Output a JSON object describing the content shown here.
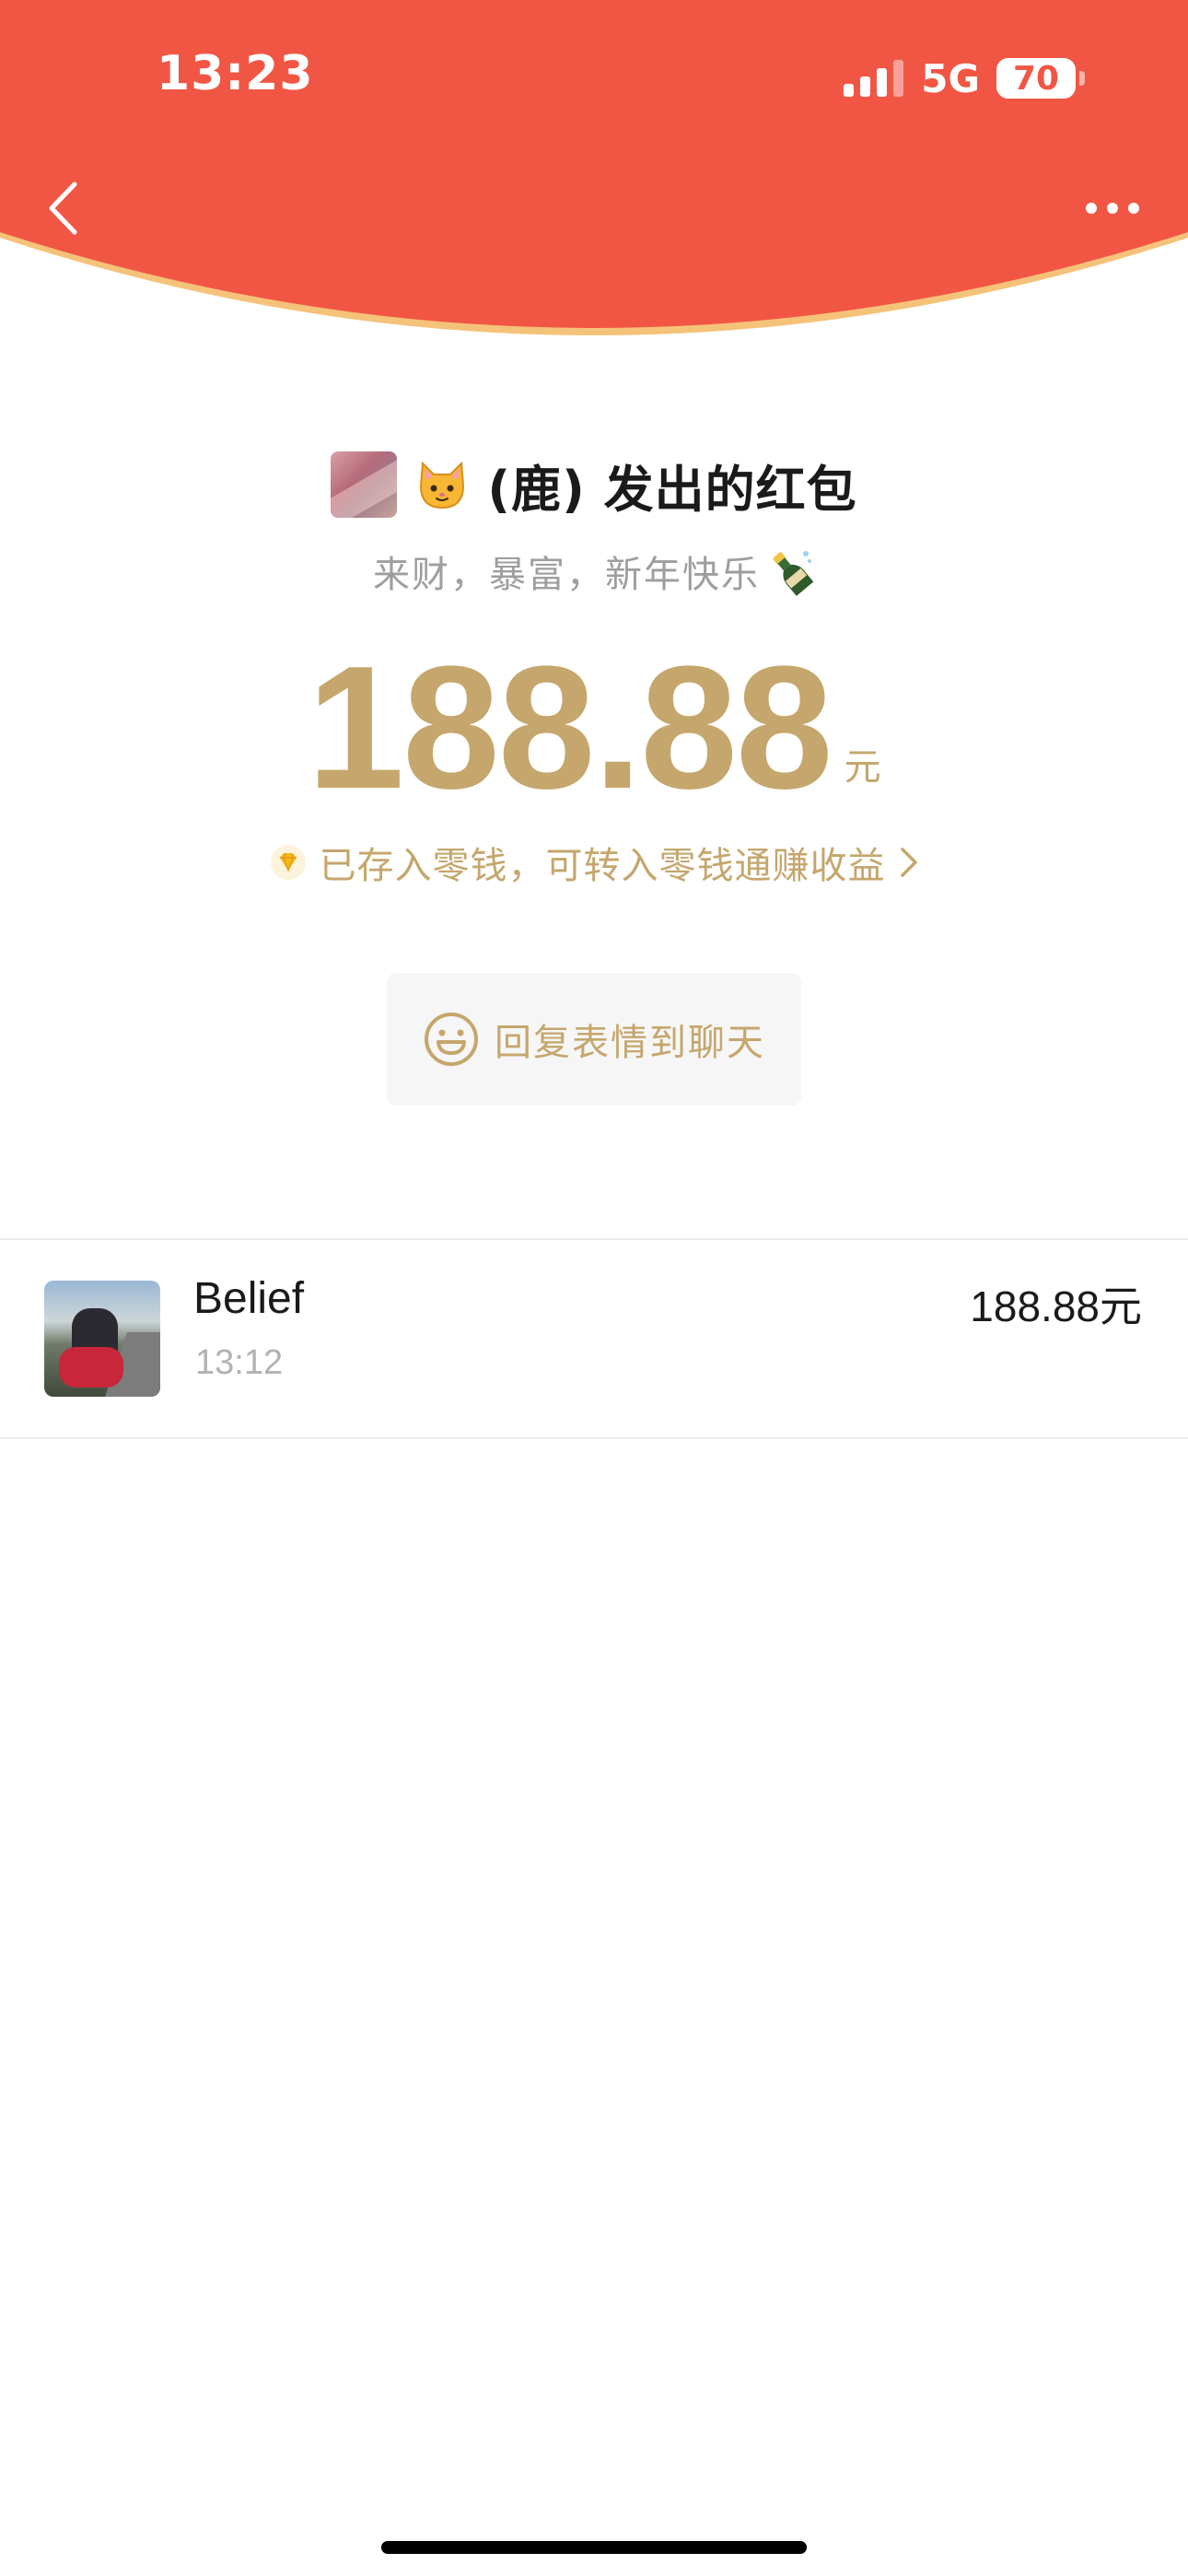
{
  "status_bar": {
    "time": "13:23",
    "network": "5G",
    "battery": "70",
    "battery_level": 0.7
  },
  "nav": {
    "back_icon": "chevron-left-icon",
    "more_icon": "more-dots-icon"
  },
  "colors": {
    "header_red": "#f15644",
    "header_edge": "#f5c27a",
    "gold": "#c5a66c",
    "text_dark": "#1a1a1a",
    "text_gray": "#9e9e9e"
  },
  "envelope": {
    "sender_emoji": "🐱",
    "sender_title": "(鹿) 发出的红包",
    "greeting": "来财，暴富，新年快乐",
    "greeting_emoji": "🍾",
    "amount": "188.88",
    "unit": "元",
    "stored_text": "已存入零钱，可转入零钱通赚收益",
    "stored_icon": "diamond-icon"
  },
  "reply": {
    "label": "回复表情到聊天",
    "icon": "smile-icon"
  },
  "receivers": [
    {
      "name": "Belief",
      "time": "13:12",
      "amount": "188.88元"
    }
  ]
}
